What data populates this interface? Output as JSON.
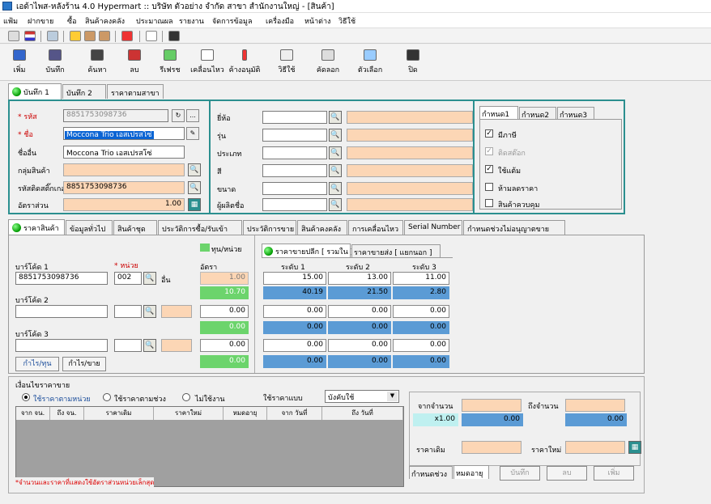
{
  "window": {
    "title": "เอด้าไพส-หลังร้าน 4.0 Hypermart :: บริษัท ตัวอย่าง จำกัด สาขา สำนักงานใหญ่ - [สินค้า]"
  },
  "menu": [
    "แฟ้ม",
    "ฝากขาย",
    "ซื้อ",
    "สินค้าคงคลัง",
    "ประมาณผล",
    "รายงาน",
    "จัดการข้อมูล",
    "เครื่องมือ",
    "หน้าต่าง",
    "วิธีใช้"
  ],
  "toolbar": {
    "add": "เพิ่ม",
    "save": "บันทึก",
    "find": "ค้นหา",
    "delete": "ลบ",
    "refresh": "รีเฟรช",
    "move": "เคลื่อนไหว",
    "pending": "ค้างอนุมัติ",
    "help": "วิธีใช้",
    "copy": "คัดลอก",
    "options": "ตัวเลือก",
    "close": "ปิด"
  },
  "top_tabs": [
    "บันทึก 1",
    "บันทึก 2",
    "ราคาตามสาขา"
  ],
  "product": {
    "code_label": "* รหัส",
    "code": "8851753098736",
    "name_label": "* ชื่อ",
    "name": "Moccona Trio เอสเปรสโซ่",
    "alias_label": "ชื่ออื่น",
    "alias": "Moccona Trio เอสเปรสโซ่",
    "group_label": "กลุ่มสินค้า",
    "group": "",
    "sticker_label": "รหัสติดสติ๊กเกอร์",
    "sticker": "8851753098736",
    "ratio_label": "อัตราส่วน",
    "ratio": "1.00",
    "ellipsis": "..."
  },
  "attrs": {
    "brand": "ยี่ห้อ",
    "model": "รุ่น",
    "type": "ประเภท",
    "color": "สี",
    "size": "ขนาด",
    "maker": "ผู้ผลิตชื่อ"
  },
  "spec_tabs": [
    "กำหนด1",
    "กำหนด2",
    "กำหนด3"
  ],
  "checks": [
    {
      "label": "มีภาษี",
      "checked": true,
      "disabled": false
    },
    {
      "label": "ติดสต๊อก",
      "checked": true,
      "disabled": true
    },
    {
      "label": "ใช้แต้ม",
      "checked": true,
      "disabled": false
    },
    {
      "label": "ห้ามลดราคา",
      "checked": false,
      "disabled": false
    },
    {
      "label": "สินค้าควบคุม",
      "checked": false,
      "disabled": false
    }
  ],
  "mid_tabs": [
    "ราคาสินค้า",
    "ข้อมูลทั่วไป",
    "สินค้าชุด",
    "ประวัติการซื้อ/รับเข้า",
    "ประวัติการขาย",
    "สินค้าคงคลัง",
    "การเคลื่อนไหว",
    "Serial Number",
    "กำหนดช่วงไม่อนุญาตขาย"
  ],
  "prices": {
    "legend": "ทุน/หน่วย",
    "barcode1_label": "บาร์โค้ด 1",
    "barcode1": "8851753098736",
    "unit_label": "* หน่วย",
    "unit": "002",
    "unit_name": "อื่น",
    "ratio_label": "อัตรา",
    "ratio1": "1.00",
    "cost1": "10.70",
    "barcode2_label": "บาร์โค้ด 2",
    "ratio2": "0.00",
    "cost2": "0.00",
    "barcode3_label": "บาร์โค้ด 3",
    "ratio3": "0.00",
    "cost3": "0.00",
    "btn_profit_cost": "กำไร/ทุน",
    "btn_profit_sale": "กำไร/ขาย"
  },
  "price_tabs": [
    "ราคาขายปลีก [ รวมใน ]",
    "ราคาขายส่ง [ แยกนอก ]"
  ],
  "levels": [
    "ระดับ 1",
    "ระดับ 2",
    "ระดับ 3"
  ],
  "price_rows": [
    [
      "15.00",
      "13.00",
      "11.00"
    ],
    [
      "40.19",
      "21.50",
      "2.80"
    ],
    [
      "0.00",
      "0.00",
      "0.00"
    ],
    [
      "0.00",
      "0.00",
      "0.00"
    ],
    [
      "0.00",
      "0.00",
      "0.00"
    ],
    [
      "0.00",
      "0.00",
      "0.00"
    ]
  ],
  "conditions": {
    "title": "เงื่อนไขราคาขาย",
    "opt1": "ใช้ราคาตามหน่วย",
    "opt2": "ใช้ราคาตามช่วง",
    "opt3": "ไม่ใช้งาน",
    "mode_label": "ใช้ราคาแบบ",
    "mode": "บังคับใช้",
    "columns": [
      "จาก จน.",
      "ถึง จน.",
      "ราคาเดิม",
      "ราคาใหม่",
      "หมดอายุ",
      "จาก วันที่",
      "ถึง วันที่"
    ],
    "note": "*จำนวนและราคาที่แสดงใช้อัตราส่วนหน่วยเล็กสุด"
  },
  "range_form": {
    "from_label": "จากจำนวน",
    "to_label": "ถึงจำนวน",
    "mult": "x1.00",
    "from_val": "0.00",
    "to_val": "0.00",
    "old_label": "ราคาเดิม",
    "new_label": "ราคาใหม่",
    "tab1": "กำหนดช่วง",
    "tab2": "หมดอายุ",
    "save": "บันทึก",
    "delete": "ลบ",
    "add": "เพิ่ม"
  }
}
